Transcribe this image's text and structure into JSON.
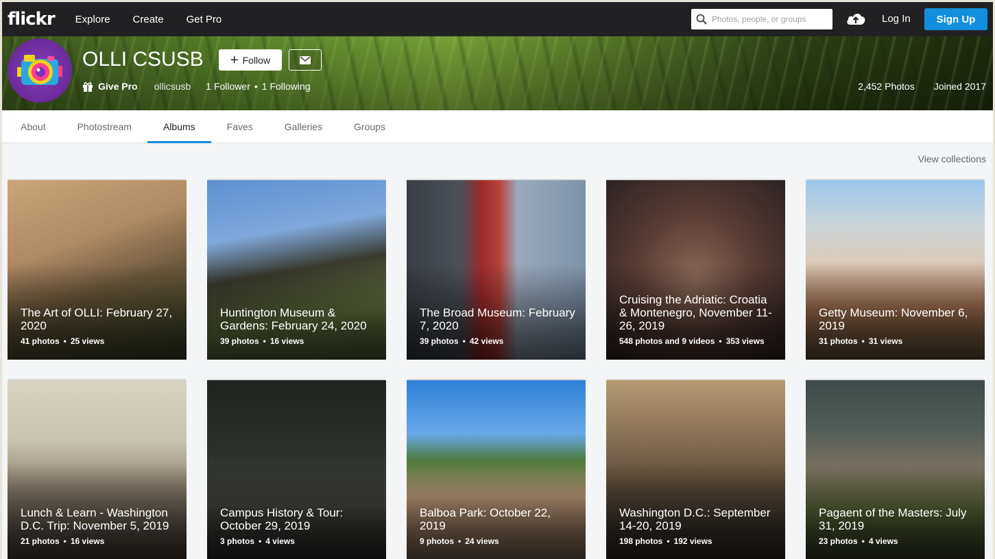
{
  "nav": {
    "logo": "flickr",
    "links": [
      "Explore",
      "Create",
      "Get Pro"
    ],
    "search_placeholder": "Photos, people, or groups",
    "login": "Log In",
    "signup": "Sign Up"
  },
  "profile": {
    "name": "OLLI CSUSB",
    "follow_label": "Follow",
    "give_pro": "Give Pro",
    "username": "ollicsusb",
    "followers": "1 Follower",
    "following": "1 Following",
    "photos": "2,452 Photos",
    "joined": "Joined 2017"
  },
  "tabs": [
    "About",
    "Photostream",
    "Albums",
    "Faves",
    "Galleries",
    "Groups"
  ],
  "active_tab": "Albums",
  "view_collections": "View collections",
  "albums": [
    {
      "title": "The Art of OLLI: February 27, 2020",
      "count": "41 photos",
      "views": "25 views"
    },
    {
      "title": "Huntington Museum & Gardens: February 24, 2020",
      "count": "39 photos",
      "views": "16 views"
    },
    {
      "title": "The Broad Museum: February 7, 2020",
      "count": "39 photos",
      "views": "42 views"
    },
    {
      "title": "Cruising the Adriatic: Croatia & Montenegro, November 11-26, 2019",
      "count": "548 photos and 9 videos",
      "views": "353 views"
    },
    {
      "title": "Getty Museum: November 6, 2019",
      "count": "31 photos",
      "views": "31 views"
    },
    {
      "title": "Lunch & Learn - Washington D.C. Trip: November 5, 2019",
      "count": "21 photos",
      "views": "16 views"
    },
    {
      "title": "Campus History & Tour: October 29, 2019",
      "count": "3 photos",
      "views": "4 views"
    },
    {
      "title": "Balboa Park: October 22, 2019",
      "count": "9 photos",
      "views": "24 views"
    },
    {
      "title": "Washington D.C.: September 14-20, 2019",
      "count": "198 photos",
      "views": "192 views"
    },
    {
      "title": "Pagaent of the Masters: July 31, 2019",
      "count": "23 photos",
      "views": "4 views"
    }
  ],
  "colors": {
    "nav_bg": "#212124",
    "signup": "#128fdc",
    "tab_underline": "#128fdc"
  }
}
